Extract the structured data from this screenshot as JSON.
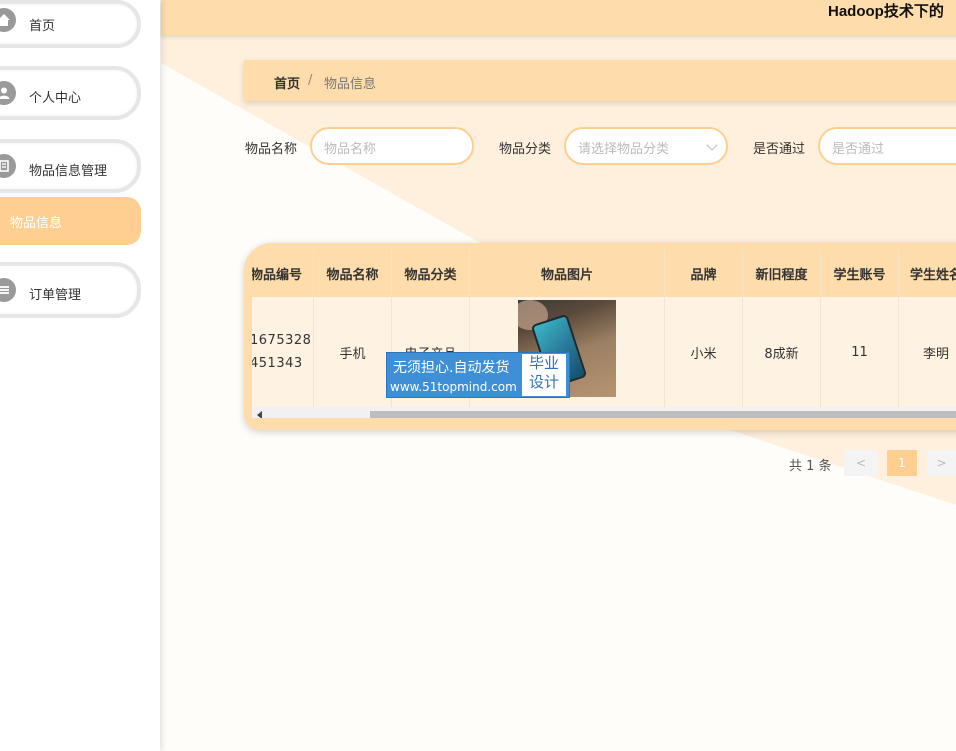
{
  "app": {
    "title": "Hadoop技术下的"
  },
  "sidebar": {
    "items": [
      {
        "label": "首页",
        "icon": "home-icon"
      },
      {
        "label": "个人中心",
        "icon": "user-icon"
      },
      {
        "label": "物品信息管理",
        "icon": "book-icon"
      },
      {
        "label": "物品信息",
        "icon": ""
      },
      {
        "label": "订单管理",
        "icon": "list-icon"
      }
    ]
  },
  "breadcrumb": {
    "home": "首页",
    "separator": "/",
    "current": "物品信息"
  },
  "search": {
    "name_label": "物品名称",
    "name_placeholder": "物品名称",
    "category_label": "物品分类",
    "category_placeholder": "请选择物品分类",
    "approved_label": "是否通过",
    "approved_placeholder": "是否通过"
  },
  "table": {
    "headers": [
      "物品编号",
      "物品名称",
      "物品分类",
      "物品图片",
      "品牌",
      "新旧程度",
      "学生账号",
      "学生姓名"
    ],
    "row": {
      "id_line1": "1675328",
      "id_line2": "451343",
      "name": "手机",
      "category": "电子产品",
      "brand": "小米",
      "condition": "8成新",
      "account": "11",
      "student": "李明"
    }
  },
  "watermark": {
    "line1": "无须担心.自动发货",
    "line2": "www.51topmind.com",
    "badge1": "毕业",
    "badge2": "设计"
  },
  "pagination": {
    "total": "共 1 条",
    "prev": "<",
    "page": "1",
    "next": ">"
  },
  "colors": {
    "accent": "#fecf91",
    "header_bg": "#fedcab",
    "row_bg": "#fef3e2",
    "watermark": "#3f8fd6"
  }
}
